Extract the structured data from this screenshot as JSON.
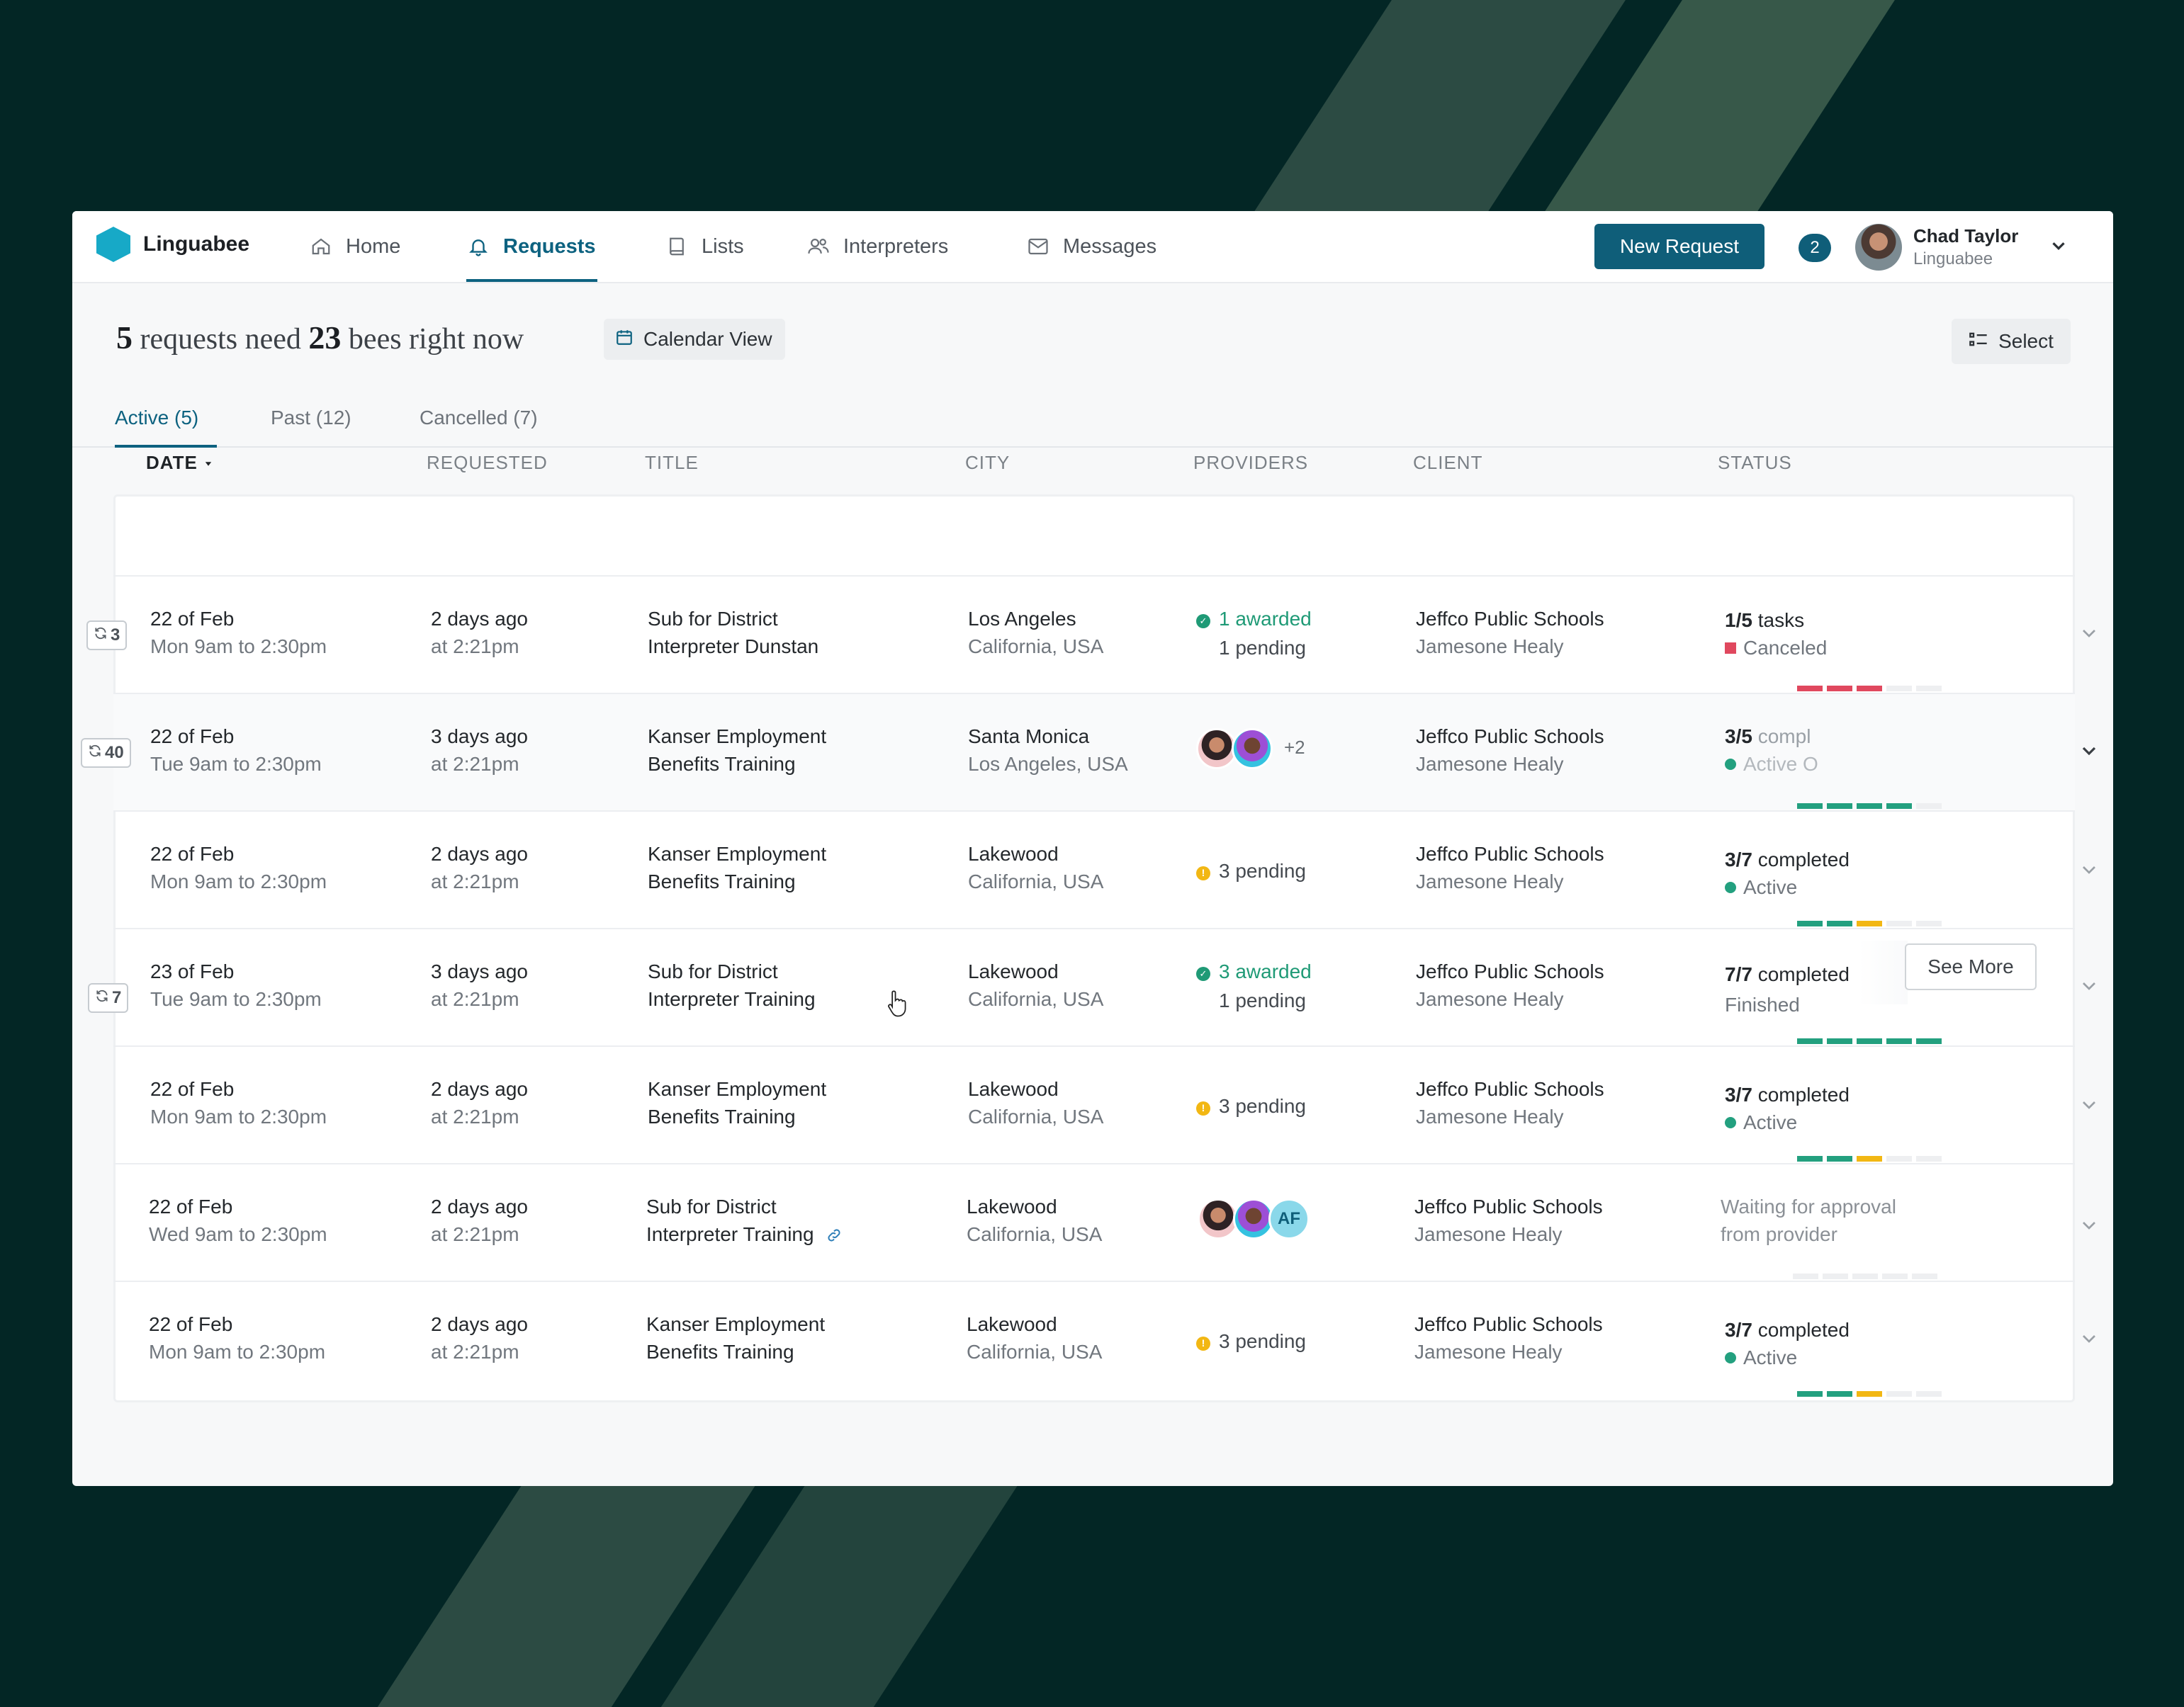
{
  "app": {
    "name": "Linguabee"
  },
  "nav": {
    "items": [
      {
        "label": "Home",
        "icon": "home-icon"
      },
      {
        "label": "Requests",
        "icon": "bell-icon",
        "active": true
      },
      {
        "label": "Lists",
        "icon": "book-icon"
      },
      {
        "label": "Interpreters",
        "icon": "users-icon"
      },
      {
        "label": "Messages",
        "icon": "mail-icon"
      }
    ],
    "new_request_label": "New Request",
    "notification_count": "2",
    "user": {
      "name": "Chad Taylor",
      "org": "Linguabee"
    }
  },
  "headline": {
    "count_requests": "5",
    "text_a": "requests need",
    "count_bees": "23",
    "text_b": "bees right now"
  },
  "calendar_view_label": "Calendar View",
  "select_label": "Select",
  "tabs": [
    {
      "label": "Active (5)",
      "active": true
    },
    {
      "label": "Past (12)"
    },
    {
      "label": "Cancelled (7)"
    }
  ],
  "table": {
    "headers": {
      "date": "DATE",
      "requested": "REQUESTED",
      "title": "TITLE",
      "city": "CITY",
      "providers": "PROVIDERS",
      "client": "CLIENT",
      "status": "STATUS"
    },
    "see_more_label": "See More",
    "rows": [
      {
        "repeat": "3",
        "date": "22 of Feb",
        "time": "Mon 9am to 2:30pm",
        "requested": "2 days ago",
        "requested_at": "at 2:21pm",
        "title1": "Sub for District",
        "title2": "Interpreter Dunstan",
        "city": "Los Angeles",
        "region": "California, USA",
        "prov_awarded": "1 awarded",
        "prov_pending": "1 pending",
        "client": "Jeffco Public Schools",
        "contact": "Jamesone Healy",
        "status_count": "1/5",
        "status_word": "tasks",
        "status_state": "Canceled",
        "progress": [
          "#e0485e",
          "#e0485e",
          "#e0485e",
          "#eeeff1",
          "#eeeff1"
        ]
      },
      {
        "repeat": "40",
        "date": "22 of Feb",
        "time": "Tue 9am to 2:30pm",
        "requested": "3 days ago",
        "requested_at": "at 2:21pm",
        "title1": "Kanser Employment",
        "title2": "Benefits Training",
        "city": "Santa Monica",
        "region": "Los Angeles, USA",
        "prov_extra": "+2",
        "client": "Jeffco Public Schools",
        "contact": "Jamesone Healy",
        "status_count": "3/5",
        "status_word": "compl",
        "status_state": "Active O",
        "progress": [
          "#23a07f",
          "#23a07f",
          "#23a07f",
          "#23a07f",
          "#eeeff1"
        ]
      },
      {
        "date": "22 of Feb",
        "time": "Mon 9am to 2:30pm",
        "requested": "2 days ago",
        "requested_at": "at 2:21pm",
        "title1": "Kanser Employment",
        "title2": "Benefits Training",
        "city": "Lakewood",
        "region": "California, USA",
        "prov_pending": "3 pending",
        "client": "Jeffco Public Schools",
        "contact": "Jamesone Healy",
        "status_count": "3/7",
        "status_word": "completed",
        "status_state": "Active",
        "progress": [
          "#23a07f",
          "#23a07f",
          "#f2b713",
          "#eeeff1",
          "#eeeff1"
        ]
      },
      {
        "repeat": "7",
        "date": "23 of Feb",
        "time": "Tue 9am to 2:30pm",
        "requested": "3 days ago",
        "requested_at": "at 2:21pm",
        "title1": "Sub for District",
        "title2": "Interpreter Training",
        "city": "Lakewood",
        "region": "California, USA",
        "prov_awarded": "3 awarded",
        "prov_pending": "1 pending",
        "client": "Jeffco Public Schools",
        "contact": "Jamesone Healy",
        "status_count": "7/7",
        "status_word": "completed",
        "status_state": "Finished",
        "progress": [
          "#23a07f",
          "#23a07f",
          "#23a07f",
          "#23a07f",
          "#23a07f"
        ]
      },
      {
        "date": "22 of Feb",
        "time": "Mon 9am to 2:30pm",
        "requested": "2 days ago",
        "requested_at": "at 2:21pm",
        "title1": "Kanser Employment",
        "title2": "Benefits Training",
        "city": "Lakewood",
        "region": "California, USA",
        "prov_pending": "3 pending",
        "client": "Jeffco Public Schools",
        "contact": "Jamesone Healy",
        "status_count": "3/7",
        "status_word": "completed",
        "status_state": "Active",
        "progress": [
          "#23a07f",
          "#23a07f",
          "#f2b713",
          "#eeeff1",
          "#eeeff1"
        ]
      },
      {
        "date": "22 of Feb",
        "time": "Wed 9am to 2:30pm",
        "requested": "2 days ago",
        "requested_at": "at 2:21pm",
        "title1": "Sub for District",
        "title2": "Interpreter Training",
        "city": "Lakewood",
        "region": "California, USA",
        "prov_initials": "AF",
        "client": "Jeffco Public Schools",
        "contact": "Jamesone Healy",
        "status_line1": "Waiting for approval",
        "status_line2": "from provider",
        "progress": [
          "#eeeff1",
          "#eeeff1",
          "#eeeff1",
          "#eeeff1",
          "#eeeff1"
        ]
      },
      {
        "date": "22 of Feb",
        "time": "Mon 9am to 2:30pm",
        "requested": "2 days ago",
        "requested_at": "at 2:21pm",
        "title1": "Kanser Employment",
        "title2": "Benefits Training",
        "city": "Lakewood",
        "region": "California, USA",
        "prov_pending": "3 pending",
        "client": "Jeffco Public Schools",
        "contact": "Jamesone Healy",
        "status_count": "3/7",
        "status_word": "completed",
        "status_state": "Active",
        "progress": [
          "#23a07f",
          "#23a07f",
          "#f2b713",
          "#eeeff1",
          "#eeeff1"
        ]
      }
    ]
  },
  "colors": {
    "accent": "#0f5e79",
    "success": "#23a07f",
    "warning": "#f2b713",
    "danger": "#e0485e"
  }
}
